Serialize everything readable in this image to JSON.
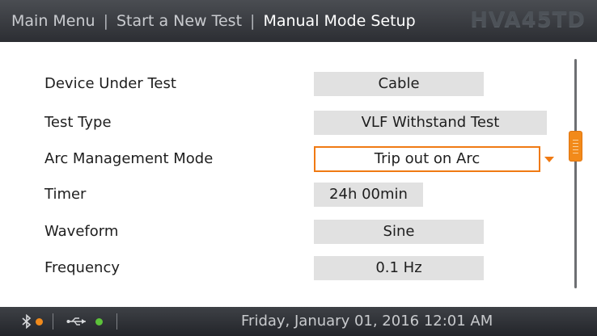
{
  "header": {
    "breadcrumbs": [
      "Main Menu",
      "Start a New Test",
      "Manual Mode Setup"
    ],
    "separator": "|",
    "brand": "HVA45TD"
  },
  "settings": [
    {
      "label": "Device Under Test",
      "value": "Cable"
    },
    {
      "label": "Test Type",
      "value": "VLF Withstand Test"
    },
    {
      "label": "Arc Management Mode",
      "value": "Trip out on Arc"
    },
    {
      "label": "Timer",
      "value": "24h 00min"
    },
    {
      "label": "Waveform",
      "value": "Sine"
    },
    {
      "label": "Frequency",
      "value": "0.1 Hz"
    }
  ],
  "status_bar": {
    "datetime": "Friday, January 01, 2016 12:01 AM",
    "bluetooth_icon": "bluetooth-icon",
    "bluetooth_status_color": "#f08a1c",
    "usb_icon": "usb-icon",
    "usb_status_color": "#5cc23a"
  },
  "colors": {
    "accent": "#f07a13",
    "value_box": "#e1e1e1",
    "header_bg": "#3a3d42"
  }
}
